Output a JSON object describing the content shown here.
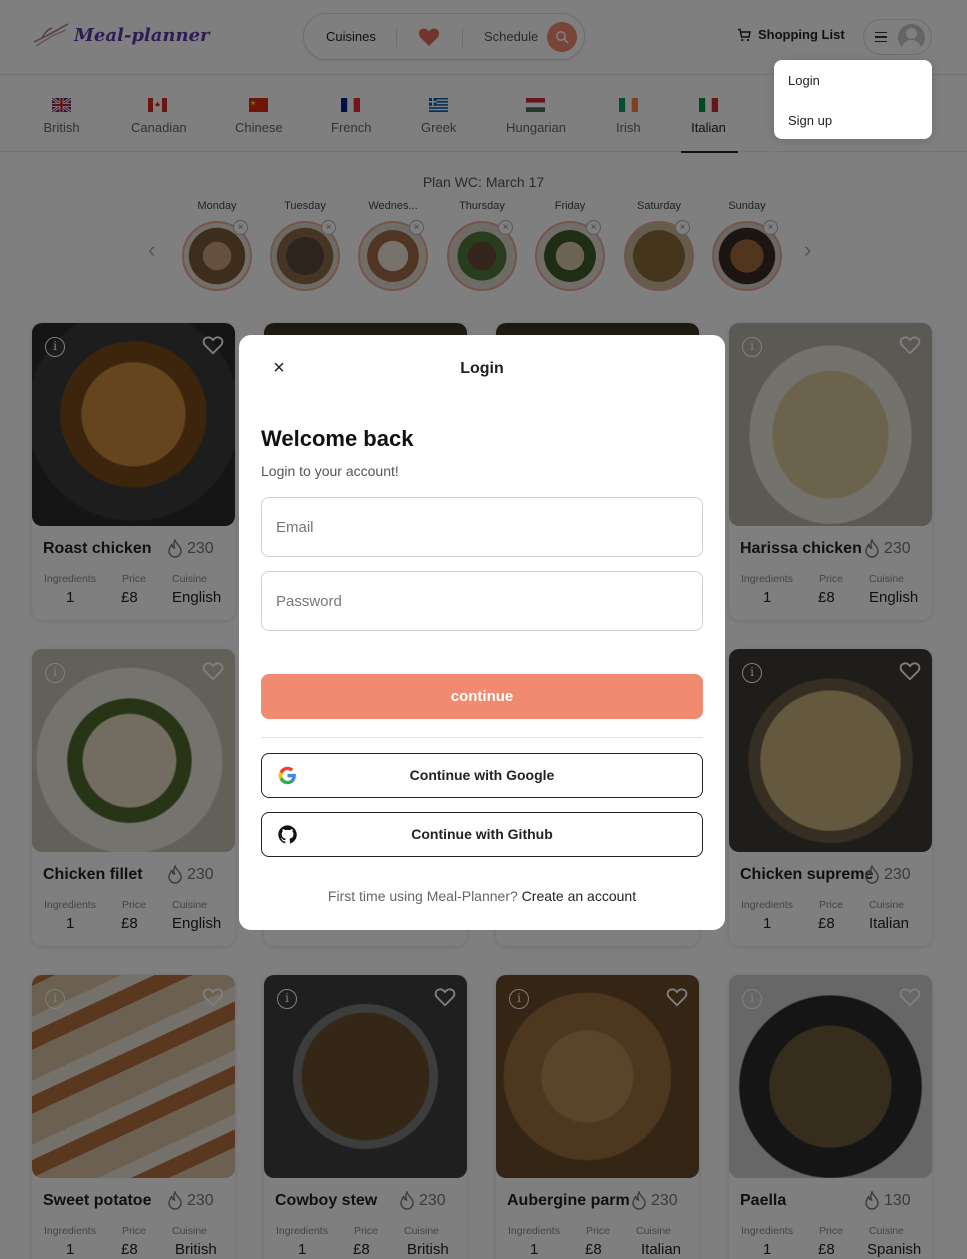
{
  "header": {
    "logo_text": "Meal-planner",
    "search": {
      "cuisines_label": "Cuisines",
      "schedule_label": "Schedule"
    },
    "shopping_list_label": "Shopping List",
    "user_menu": {
      "items": [
        "Login",
        "Sign up"
      ]
    }
  },
  "cuisine_tabs": {
    "items": [
      "British",
      "Canadian",
      "Chinese",
      "French",
      "Greek",
      "Hungarian",
      "Irish",
      "Italian"
    ],
    "active": "Italian"
  },
  "plan": {
    "title": "Plan WC: March 17",
    "days": [
      "Monday",
      "Tuesday",
      "Wednes...",
      "Thursday",
      "Friday",
      "Saturday",
      "Sunday"
    ]
  },
  "meta_labels": {
    "ingredients": "Ingredients",
    "price": "Price",
    "cuisine": "Cuisine"
  },
  "cards": [
    {
      "title": "Roast chicken",
      "calories": "230",
      "ingredients": "1",
      "price": "£8",
      "cuisine": "English"
    },
    {
      "title": "Harissa chicken",
      "calories": "230",
      "ingredients": "1",
      "price": "£8",
      "cuisine": "English"
    },
    {
      "title": "Chicken fillet",
      "calories": "230",
      "ingredients": "1",
      "price": "£8",
      "cuisine": "English"
    },
    {
      "title": "Chicken supreme",
      "calories": "230",
      "ingredients": "1",
      "price": "£8",
      "cuisine": "Italian"
    },
    {
      "title": "Sweet potatoe",
      "calories": "230",
      "ingredients": "1",
      "price": "£8",
      "cuisine": "British"
    },
    {
      "title": "Cowboy stew",
      "calories": "230",
      "ingredients": "1",
      "price": "£8",
      "cuisine": "British"
    },
    {
      "title": "Aubergine parm",
      "calories": "230",
      "ingredients": "1",
      "price": "£8",
      "cuisine": "Italian"
    },
    {
      "title": "Paella",
      "calories": "130",
      "ingredients": "1",
      "price": "£8",
      "cuisine": "Spanish"
    }
  ],
  "login_modal": {
    "title": "Login",
    "heading": "Welcome back",
    "subheading": "Login to your account!",
    "email_placeholder": "Email",
    "password_placeholder": "Password",
    "continue_label": "continue",
    "google_label": "Continue with Google",
    "github_label": "Continue with Github",
    "footer_text": "First time using Meal-Planner?",
    "footer_link": "Create an account"
  },
  "colors": {
    "accent": "#f08a70",
    "overlay": "rgba(0,0,0,0.5)"
  }
}
